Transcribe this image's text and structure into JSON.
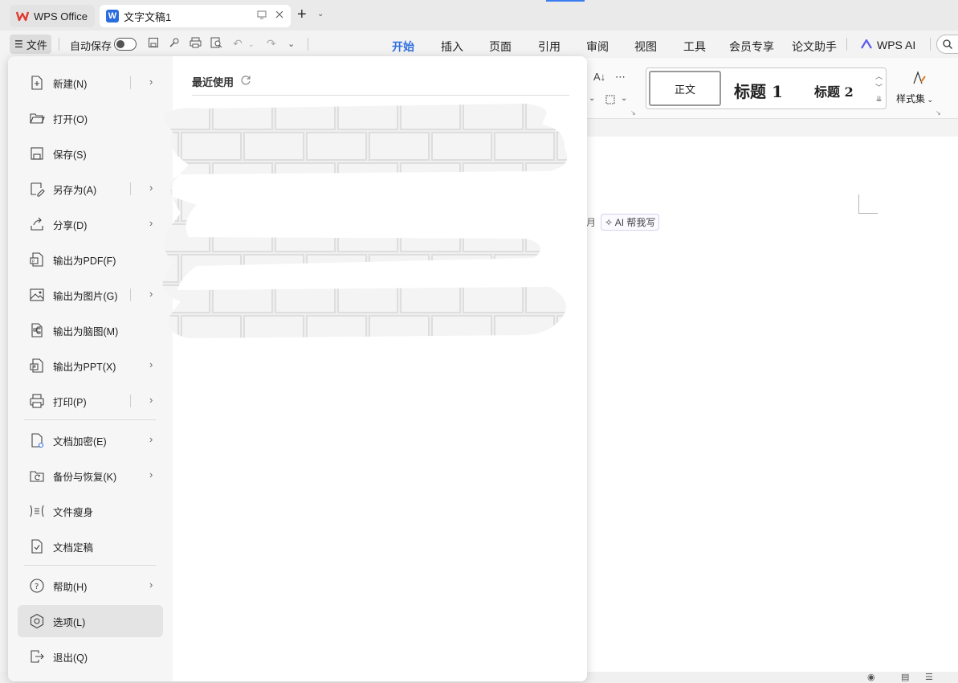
{
  "titlebar": {
    "tabs": [
      {
        "label": "WPS Office"
      },
      {
        "label": "文字文稿1"
      }
    ]
  },
  "toolbar": {
    "file_label": "文件",
    "autosave_label": "自动保存"
  },
  "ribbon_tabs": [
    "开始",
    "插入",
    "页面",
    "引用",
    "审阅",
    "视图",
    "工具",
    "会员专享",
    "论文助手"
  ],
  "wps_ai_label": "WPS AI",
  "styles": {
    "normal": "正文",
    "heading1": "标题 1",
    "heading2": "标题 2",
    "styleset_label": "样式集"
  },
  "document": {
    "ai_prefix": "月",
    "ai_button": "AI 帮我写"
  },
  "file_menu": {
    "items": [
      {
        "label": "新建(N)",
        "icon": "new-doc-icon",
        "submenu": true
      },
      {
        "label": "打开(O)",
        "icon": "folder-open-icon",
        "submenu": false
      },
      {
        "label": "保存(S)",
        "icon": "save-icon",
        "submenu": false
      },
      {
        "label": "另存为(A)",
        "icon": "save-as-icon",
        "submenu": true
      },
      {
        "label": "分享(D)",
        "icon": "share-icon",
        "submenu": true
      },
      {
        "label": "输出为PDF(F)",
        "icon": "pdf-icon",
        "submenu": false
      },
      {
        "label": "输出为图片(G)",
        "icon": "image-icon",
        "submenu": true
      },
      {
        "label": "输出为脑图(M)",
        "icon": "mindmap-icon",
        "submenu": false
      },
      {
        "label": "输出为PPT(X)",
        "icon": "ppt-icon",
        "submenu": true
      },
      {
        "label": "打印(P)",
        "icon": "print-icon",
        "submenu": true
      },
      {
        "label": "文档加密(E)",
        "icon": "encrypt-icon",
        "submenu": true
      },
      {
        "label": "备份与恢复(K)",
        "icon": "backup-icon",
        "submenu": true
      },
      {
        "label": "文件瘦身",
        "icon": "slim-icon",
        "submenu": false
      },
      {
        "label": "文档定稿",
        "icon": "finalize-icon",
        "submenu": false
      },
      {
        "label": "帮助(H)",
        "icon": "help-icon",
        "submenu": true
      },
      {
        "label": "选项(L)",
        "icon": "options-icon",
        "submenu": false,
        "selected": true
      },
      {
        "label": "退出(Q)",
        "icon": "exit-icon",
        "submenu": false
      }
    ]
  },
  "recent": {
    "title": "最近使用"
  },
  "colors": {
    "accent": "#2f6fe0",
    "wps_red": "#e23a2f",
    "doc_blue": "#2b6cde",
    "ai_purple": "#5b5bf0"
  }
}
